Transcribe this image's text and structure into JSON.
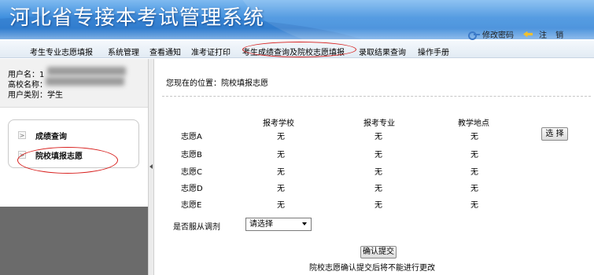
{
  "header": {
    "title": "河北省专接本考试管理系统",
    "change_password": "修改密码",
    "logout": "注 销",
    "gradient_color": "#3f8fde"
  },
  "nav": {
    "items": [
      {
        "label": "考生专业志愿填报"
      },
      {
        "label": "系统管理"
      },
      {
        "label": "查看通知"
      },
      {
        "label": "准考证打印"
      },
      {
        "label": "考生成绩查询及院校志愿填报"
      },
      {
        "label": "录取结果查询"
      },
      {
        "label": "操作手册"
      }
    ],
    "highlight_color": "#d8201e"
  },
  "user": {
    "username_label": "用户名：",
    "username_value": "1",
    "school_label": "高校名称：",
    "type_label": "用户类别：",
    "type_value": "学生"
  },
  "sidebar_menu": {
    "items": [
      {
        "label": "成绩查询",
        "arrow": ">"
      },
      {
        "label": "院校填报志愿",
        "arrow": ">"
      }
    ]
  },
  "breadcrumb": {
    "text": "您现在的位置：院校填报志愿"
  },
  "table": {
    "headers": [
      "报考学校",
      "报考专业",
      "教学地点"
    ],
    "rows": [
      {
        "label": "志愿A",
        "school": "无",
        "major": "无",
        "location": "无"
      },
      {
        "label": "志愿B",
        "school": "无",
        "major": "无",
        "location": "无"
      },
      {
        "label": "志愿C",
        "school": "无",
        "major": "无",
        "location": "无"
      },
      {
        "label": "志愿D",
        "school": "无",
        "major": "无",
        "location": "无"
      },
      {
        "label": "志愿E",
        "school": "无",
        "major": "无",
        "location": "无"
      }
    ],
    "select_button": "选 择"
  },
  "adjust": {
    "label": "是否服从调剂",
    "selected": "请选择"
  },
  "submit": {
    "button": "确认提交",
    "note": "院校志愿确认提交后将不能进行更改"
  }
}
